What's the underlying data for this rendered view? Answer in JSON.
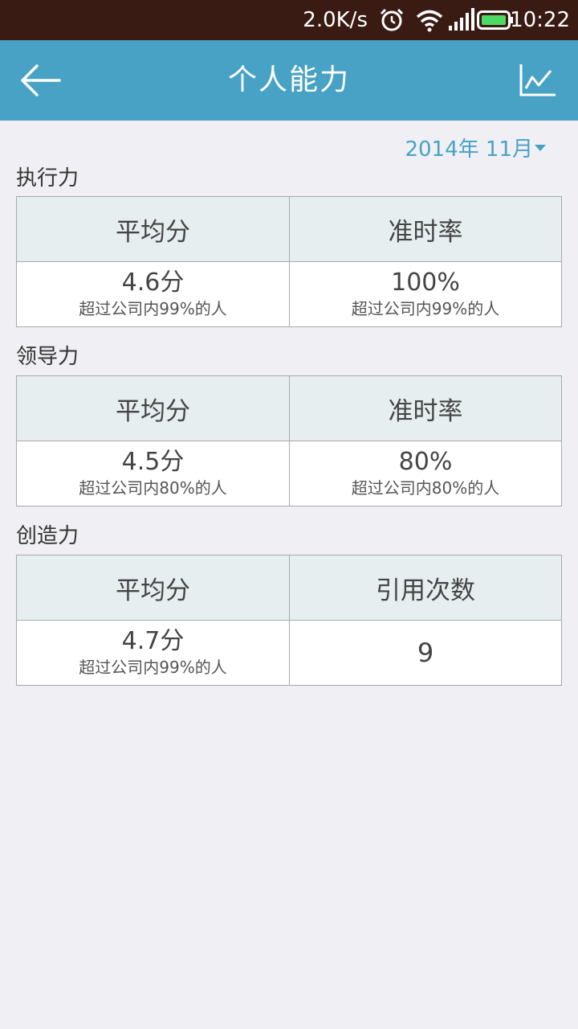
{
  "status_bar": {
    "net_speed": "2.0K/s",
    "time": "10:22",
    "icons": [
      "alarm-icon",
      "wifi-icon",
      "signal-icon",
      "battery-icon"
    ],
    "battery_color": "#4cd964"
  },
  "app_bar": {
    "title": "个人能力",
    "back_icon": "arrow-left-icon",
    "chart_icon": "line-chart-icon",
    "color": "#48a2c5"
  },
  "date_picker": {
    "label": "2014年 11月"
  },
  "sections": [
    {
      "title": "执行力",
      "headers": [
        "平均分",
        "准时率"
      ],
      "cells": [
        {
          "value": "4.6分",
          "note": "超过公司内99%的人"
        },
        {
          "value": "100%",
          "note": "超过公司内99%的人"
        }
      ]
    },
    {
      "title": "领导力",
      "headers": [
        "平均分",
        "准时率"
      ],
      "cells": [
        {
          "value": "4.5分",
          "note": "超过公司内80%的人"
        },
        {
          "value": "80%",
          "note": "超过公司内80%的人"
        }
      ]
    },
    {
      "title": "创造力",
      "headers": [
        "平均分",
        "引用次数"
      ],
      "cells": [
        {
          "value": "4.7分",
          "note": "超过公司内99%的人"
        },
        {
          "value": "9",
          "note": ""
        }
      ]
    }
  ]
}
